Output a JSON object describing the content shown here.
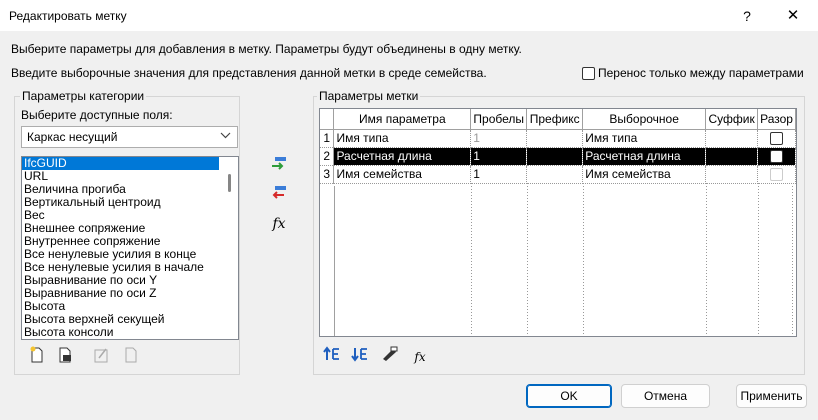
{
  "window": {
    "title": "Редактировать метку",
    "help": "?",
    "close": "✕"
  },
  "intro": {
    "line1": "Выберите параметры для добавления в метку.  Параметры будут объединены в одну метку.",
    "line2": "Введите выборочные значения для представления данной метки в среде семейства."
  },
  "transfer_checkbox": {
    "label": "Перенос только между параметрами",
    "checked": false
  },
  "category": {
    "legend": "Параметры категории",
    "field_label": "Выберите доступные поля:",
    "selected_category": "Каркас несущий",
    "items": [
      "IfcGUID",
      "URL",
      "Величина прогиба",
      "Вертикальный центроид",
      "Вес",
      "Внешнее сопряжение",
      "Внутреннее сопряжение",
      "Все ненулевые усилия в конце",
      "Все ненулевые усилия в начале",
      "Выравнивание по оси Y",
      "Выравнивание по оси Z",
      "Высота",
      "Высота верхней секущей",
      "Высота консоли"
    ],
    "selected_index": 0
  },
  "middle_buttons": {
    "add_icon": "add-to-label-icon",
    "remove_icon": "remove-from-label-icon",
    "fx_label": "fx"
  },
  "label": {
    "legend": "Параметры метки",
    "columns": [
      "",
      "Имя параметра",
      "Пробелы",
      "Префикс",
      "Выборочное",
      "Суффик",
      "Разор"
    ],
    "rows": [
      {
        "num": "1",
        "name": "Имя типа",
        "spaces": "1",
        "prefix": "",
        "sample": "Имя типа",
        "suffix": "",
        "break": false
      },
      {
        "num": "2",
        "name": "Расчетная длина",
        "spaces": "1",
        "prefix": "",
        "sample": "Расчетная длина",
        "suffix": "",
        "break": false
      },
      {
        "num": "3",
        "name": "Имя семейства",
        "spaces": "1",
        "prefix": "",
        "sample": "Имя семейства",
        "suffix": "",
        "break": false
      }
    ],
    "highlighted_row": 1
  },
  "buttons": {
    "ok": "OK",
    "cancel": "Отмена",
    "apply": "Применить"
  }
}
